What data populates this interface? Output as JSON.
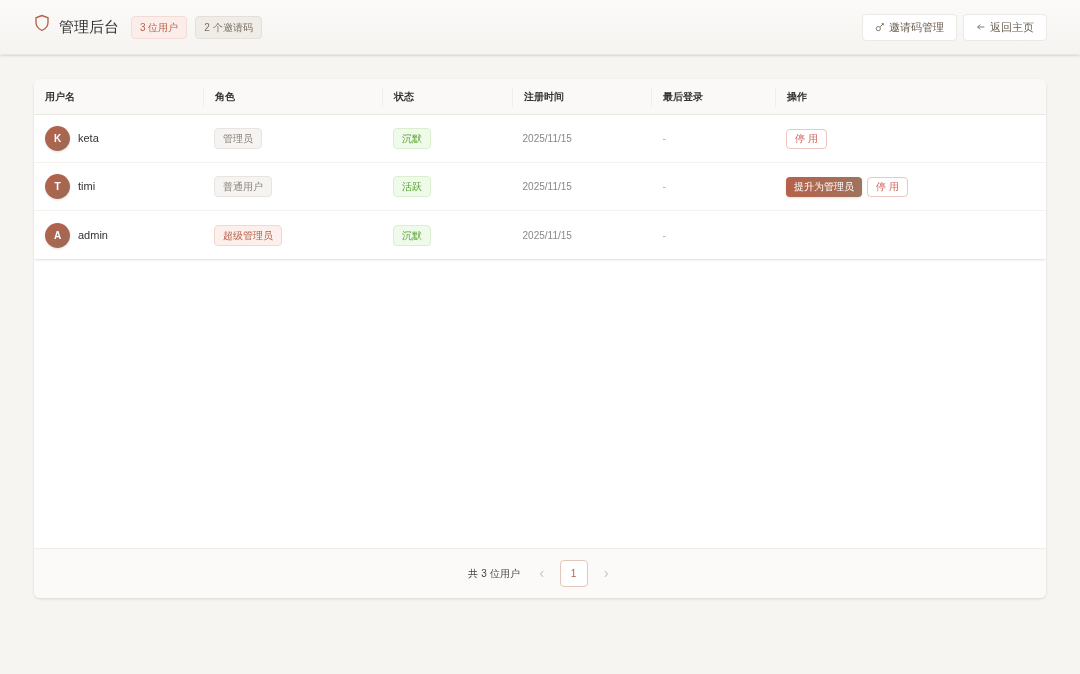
{
  "header": {
    "title": "管理后台",
    "badges": [
      {
        "label": "3 位用户",
        "kind": "accent"
      },
      {
        "label": "2 个邀请码",
        "kind": "neutral"
      }
    ],
    "buttons": [
      {
        "label": "邀请码管理",
        "kind": "invite"
      },
      {
        "label": "返回主页",
        "kind": "back"
      }
    ]
  },
  "table": {
    "columns": [
      "用户名",
      "角色",
      "状态",
      "注册时间",
      "最后登录",
      "操作"
    ],
    "rows": [
      {
        "avatar": "K",
        "name": "keta",
        "role": {
          "label": "管理员",
          "kind": "admin"
        },
        "status": "沉默",
        "registered": "2025/11/15",
        "last_login": "-",
        "actions": [
          {
            "label": "停 用",
            "kind": "outline"
          }
        ]
      },
      {
        "avatar": "T",
        "name": "timi",
        "role": {
          "label": "普通用户",
          "kind": "user"
        },
        "status": "活跃",
        "registered": "2025/11/15",
        "last_login": "-",
        "actions": [
          {
            "label": "提升为管理员",
            "kind": "primary"
          },
          {
            "label": "停 用",
            "kind": "outline"
          }
        ]
      },
      {
        "avatar": "A",
        "name": "admin",
        "role": {
          "label": "超级管理员",
          "kind": "super"
        },
        "status": "沉默",
        "registered": "2025/11/15",
        "last_login": "-",
        "actions": []
      }
    ]
  },
  "pagination": {
    "total": "共 3 位用户",
    "pages": [
      {
        "label": "1",
        "selected": true
      }
    ],
    "prev_disabled": true,
    "next_disabled": true
  }
}
